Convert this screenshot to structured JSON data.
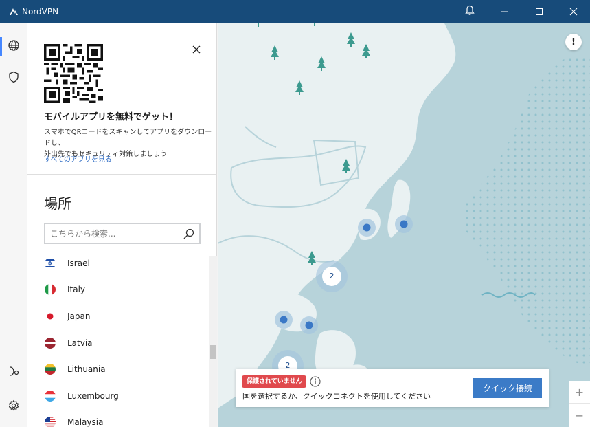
{
  "window": {
    "title": "NordVPN"
  },
  "colors": {
    "titlebar": "#174b7a",
    "accent": "#3b7bc7",
    "danger": "#e0494d",
    "map_water": "#b7d3da",
    "map_land": "#e9f1f2",
    "server_pin": "#3a78c6"
  },
  "titlebar_icons": [
    "nordvpn-logo-icon",
    "bell-icon",
    "minimize-icon",
    "maximize-icon",
    "close-icon"
  ],
  "rail": {
    "items": [
      "globe-icon",
      "shield-icon",
      "meshnet-icon",
      "gear-icon"
    ]
  },
  "promo": {
    "title": "モバイルアプリを無料でゲット！",
    "desc_line1": "スマホでQRコードをスキャンしてアプリをダウンロードし、",
    "desc_line2": "外出先でもセキュリティ対策しましょう",
    "link": "すべてのアプリを見る"
  },
  "locations": {
    "title": "場所",
    "search_placeholder": "こちらから検索...",
    "countries": [
      {
        "name": "Israel",
        "flag": "israel"
      },
      {
        "name": "Italy",
        "flag": "italy"
      },
      {
        "name": "Japan",
        "flag": "japan"
      },
      {
        "name": "Latvia",
        "flag": "latvia"
      },
      {
        "name": "Lithuania",
        "flag": "lithuania"
      },
      {
        "name": "Luxembourg",
        "flag": "luxembourg"
      },
      {
        "name": "Malaysia",
        "flag": "malaysia"
      }
    ]
  },
  "map": {
    "info_glyph": "!",
    "clusters": [
      {
        "count": "2"
      },
      {
        "count": "2"
      }
    ],
    "zoom_in": "+",
    "zoom_out": "−"
  },
  "status": {
    "badge": "保護されていません",
    "message": "国を選択するか、クイックコネクトを使用してください",
    "quick_connect": "クイック接続"
  }
}
